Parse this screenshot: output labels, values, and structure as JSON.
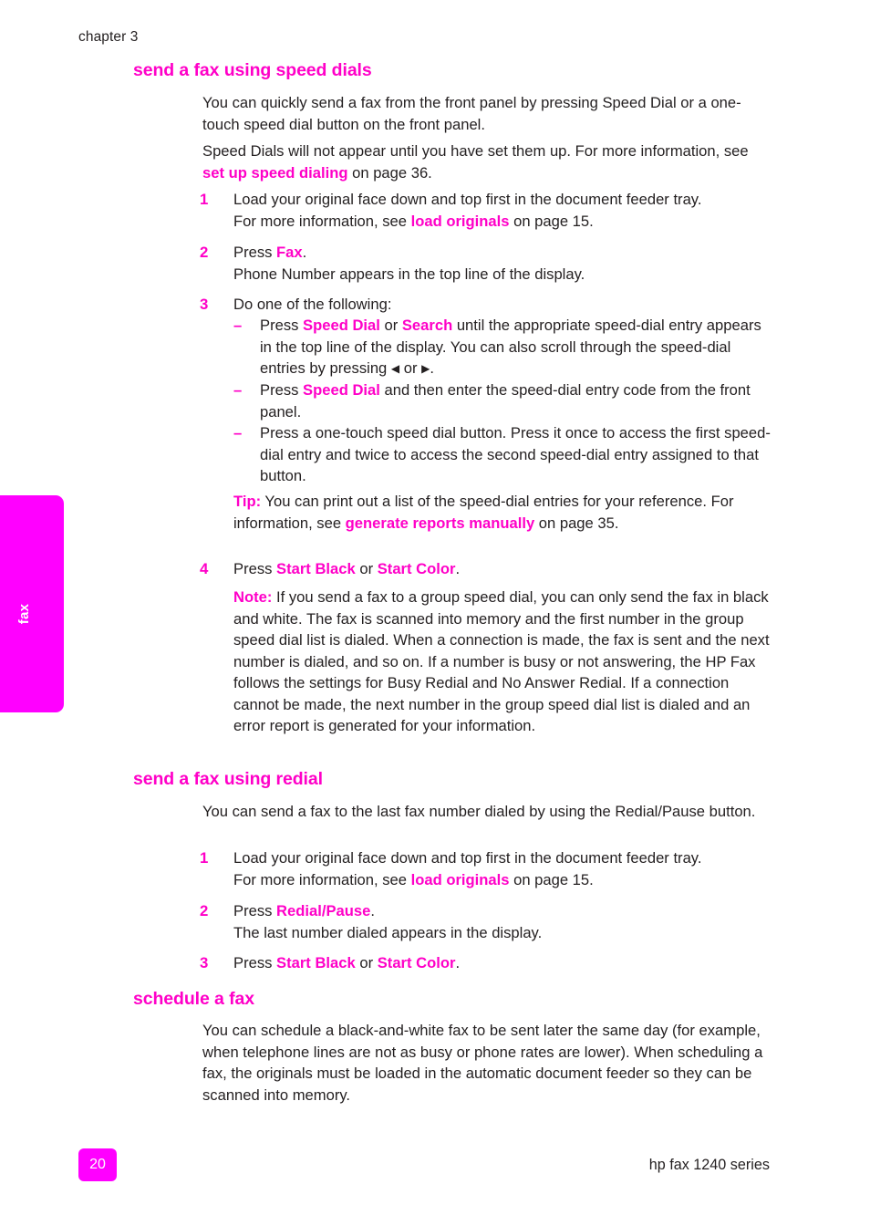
{
  "header": {
    "chapter": "chapter 3"
  },
  "side_tab": {
    "label": "fax"
  },
  "sections": [
    {
      "heading": "send a fax using speed dials",
      "intro_1": "You can quickly send a fax from the front panel by pressing Speed Dial or a one-touch speed dial button on the front panel.",
      "intro_2_a": "Speed Dials will not appear until you have set them up. For more information, see ",
      "intro_2_link": "set up speed dialing",
      "intro_2_b": " on page 36.",
      "step1_num": "1",
      "step1_line1": "Load your original face down and top first in the document feeder tray.",
      "step1_line2_a": "For more information, see ",
      "step1_line2_link": "load originals",
      "step1_line2_b": " on page 15.",
      "step2_num": "2",
      "step2_line1_a": "Press ",
      "step2_line1_key": "Fax",
      "step2_line1_b": ".",
      "step2_line2": "Phone Number appears in the top line of the display.",
      "step3_num": "3",
      "step3_line1": "Do one of the following:",
      "dash": "–",
      "bullet1_a": "Press ",
      "bullet1_key1": "Speed Dial",
      "bullet1_b": " or ",
      "bullet1_key2": "Search",
      "bullet1_c": " until the appropriate speed-dial entry appears in the top line of the display. You can also scroll through the speed-dial entries by pressing ",
      "bullet1_arrow_left": "◀",
      "bullet1_d": " or ",
      "bullet1_arrow_right": "▶",
      "bullet1_e": ".",
      "bullet2_a": "Press ",
      "bullet2_key": "Speed Dial",
      "bullet2_b": " and then enter the speed-dial entry code from the front panel.",
      "bullet3": "Press a one-touch speed dial button. Press it once to access the first speed-dial entry and twice to access the second speed-dial entry assigned to that button.",
      "tip_label": "Tip:",
      "tip_a": "  You can print out a list of the speed-dial entries for your reference. For information, see ",
      "tip_link": "generate reports manually",
      "tip_b": " on page 35.",
      "step4_num": "4",
      "step4_a": "Press ",
      "step4_key1": "Start Black",
      "step4_b": " or ",
      "step4_key2": "Start Color",
      "step4_c": ".",
      "note_label": "Note:",
      "note_text": "  If you send a fax to a group speed dial, you can only send the fax in black and white. The fax is scanned into memory and the first number in the group speed dial list is dialed. When a connection is made, the fax is sent and the next number is dialed, and so on. If a number is busy or not answering, the HP Fax follows the settings for Busy Redial and No Answer Redial. If a connection cannot be made, the next number in the group speed dial list is dialed and an error report is generated for your information."
    },
    {
      "heading": "send a fax using redial",
      "intro": "You can send a fax to the last fax number dialed by using the Redial/Pause button.",
      "step1_num": "1",
      "step1_line1": "Load your original face down and top first in the document feeder tray.",
      "step1_line2_a": "For more information, see ",
      "step1_line2_link": "load originals",
      "step1_line2_b": " on page 15.",
      "step2_num": "2",
      "step2_line1_a": "Press ",
      "step2_line1_key": "Redial/Pause",
      "step2_line1_b": ".",
      "step2_line2": "The last number dialed appears in the display.",
      "step3_num": "3",
      "step3_a": "Press ",
      "step3_key1": "Start Black",
      "step3_b": " or ",
      "step3_key2": "Start Color",
      "step3_c": "."
    },
    {
      "heading": "schedule a fax",
      "intro": "You can schedule a black-and-white fax to be sent later the same day (for example, when telephone lines are not as busy or phone rates are lower). When scheduling a fax, the originals must be loaded in the automatic document feeder so they can be scanned into memory."
    }
  ],
  "footer": {
    "page_number": "20",
    "product": "hp fax 1240 series"
  },
  "colors": {
    "accent_magenta": "#ff00ff",
    "heading_magenta": "#ff00c8",
    "body_text": "#231f20"
  }
}
